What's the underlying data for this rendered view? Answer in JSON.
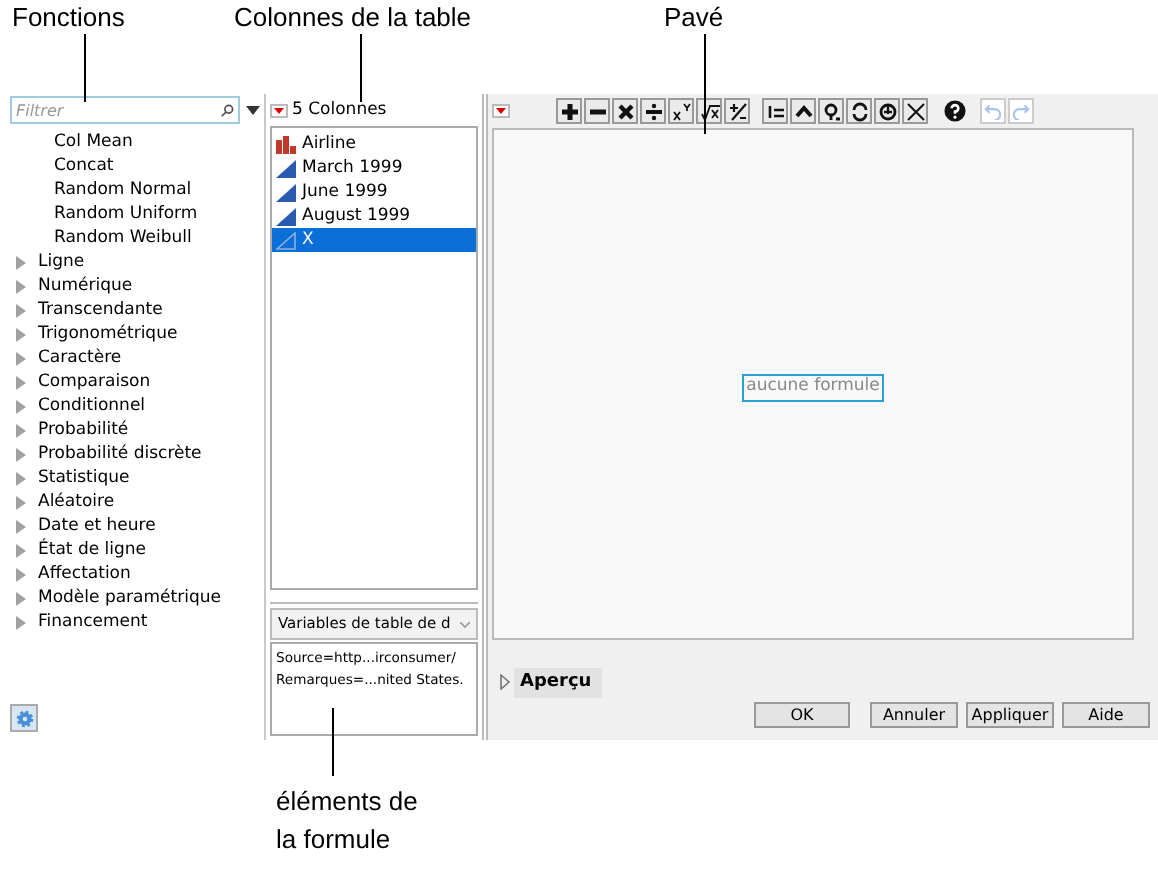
{
  "callouts": {
    "top": [
      "Fonctions",
      "Colonnes de la table",
      "Pavé"
    ],
    "bottom": "éléments de la formule"
  },
  "functions": {
    "filter": {
      "placeholder": "Filtrer"
    },
    "items": [
      {
        "label": "Col Mean",
        "kind": "leaf"
      },
      {
        "label": "Concat",
        "kind": "leaf"
      },
      {
        "label": "Random Normal",
        "kind": "leaf"
      },
      {
        "label": "Random Uniform",
        "kind": "leaf"
      },
      {
        "label": "Random Weibull",
        "kind": "leaf"
      },
      {
        "label": "Ligne",
        "kind": "group",
        "expanded": false
      },
      {
        "label": "Numérique",
        "kind": "group",
        "expanded": false
      },
      {
        "label": "Transcendante",
        "kind": "group",
        "expanded": false
      },
      {
        "label": "Trigonométrique",
        "kind": "group",
        "expanded": false
      },
      {
        "label": "Caractère",
        "kind": "group",
        "expanded": false
      },
      {
        "label": "Comparaison",
        "kind": "group",
        "expanded": false
      },
      {
        "label": "Conditionnel",
        "kind": "group",
        "expanded": false
      },
      {
        "label": "Probabilité",
        "kind": "group",
        "expanded": false
      },
      {
        "label": "Probabilité discrète",
        "kind": "group",
        "expanded": false
      },
      {
        "label": "Statistique",
        "kind": "group",
        "expanded": false
      },
      {
        "label": "Aléatoire",
        "kind": "group",
        "expanded": false
      },
      {
        "label": "Date et heure",
        "kind": "group",
        "expanded": false
      },
      {
        "label": "État de ligne",
        "kind": "group",
        "expanded": false
      },
      {
        "label": "Affectation",
        "kind": "group",
        "expanded": false
      },
      {
        "label": "Modèle paramétrique",
        "kind": "group",
        "expanded": false
      },
      {
        "label": "Financement",
        "kind": "group",
        "expanded": false
      }
    ]
  },
  "columns": {
    "header": "5 Colonnes",
    "items": [
      {
        "label": "Airline",
        "kind": "nominal",
        "selected": false
      },
      {
        "label": "March 1999",
        "kind": "continuous",
        "selected": false
      },
      {
        "label": "June 1999",
        "kind": "continuous",
        "selected": false
      },
      {
        "label": "August 1999",
        "kind": "continuous",
        "selected": false
      },
      {
        "label": "X",
        "kind": "continuous",
        "selected": true
      }
    ],
    "variables_select": "Variables de table de d",
    "variables": [
      "Source=http...irconsumer/",
      "Remarques=...nited States."
    ]
  },
  "keypad": {
    "buttons": [
      {
        "kind": "plus"
      },
      {
        "kind": "minus"
      },
      {
        "kind": "times"
      },
      {
        "kind": "divide"
      },
      {
        "kind": "power"
      },
      {
        "kind": "root"
      },
      {
        "kind": "negate"
      },
      {
        "kind": "assign"
      },
      {
        "kind": "caret"
      },
      {
        "kind": "lookup"
      },
      {
        "kind": "swap"
      },
      {
        "kind": "local"
      },
      {
        "kind": "delete"
      },
      {
        "kind": "help"
      }
    ],
    "undo_enabled": false,
    "redo_enabled": false
  },
  "editor": {
    "formula": "aucune formule"
  },
  "preview": {
    "label": "Aperçu",
    "expanded": false
  },
  "buttons": [
    "OK",
    "Annuler",
    "Appliquer",
    "Aide"
  ]
}
